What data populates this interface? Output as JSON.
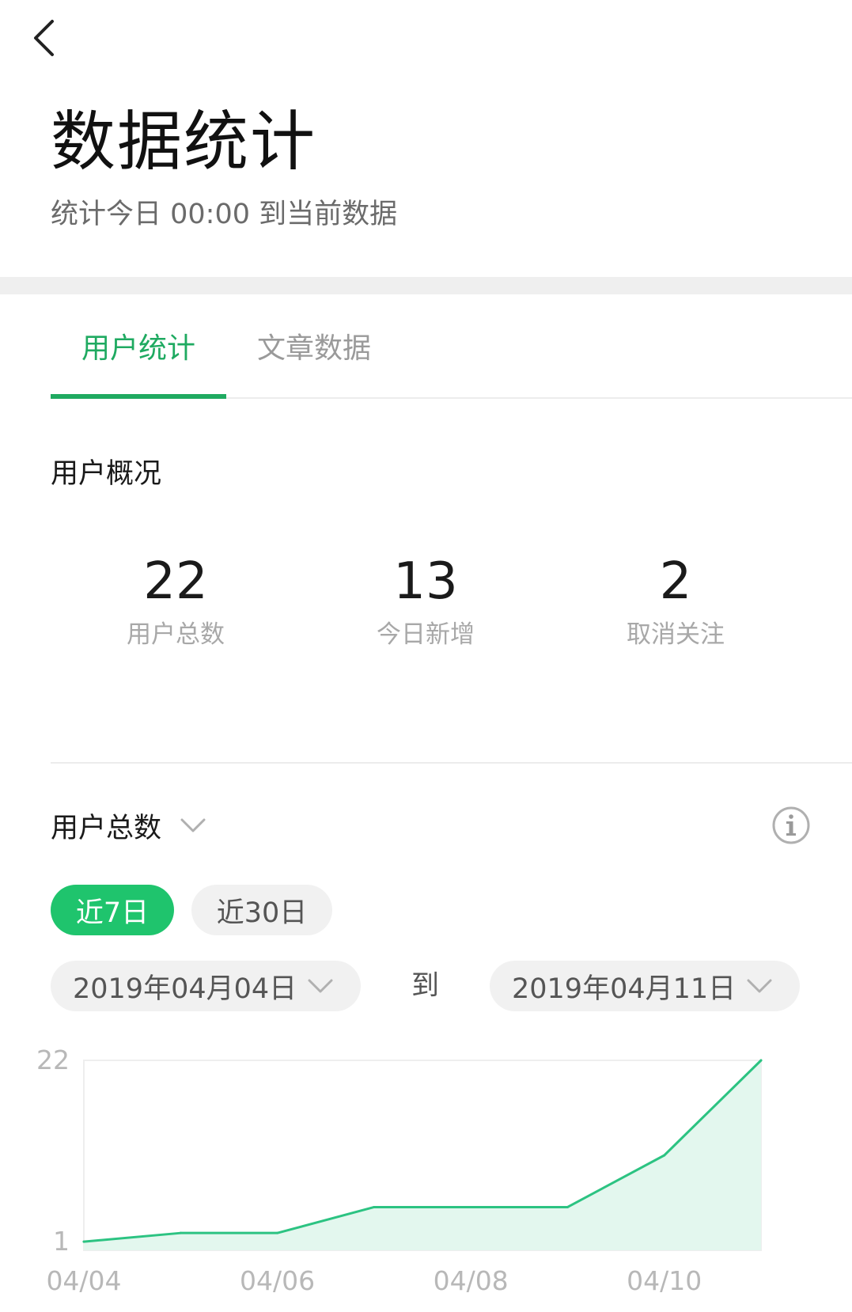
{
  "header": {
    "back_icon": "chevron-left-icon",
    "title": "数据统计",
    "subtitle": "统计今日 00:00 到当前数据"
  },
  "tabs": [
    {
      "label": "用户统计",
      "active": true
    },
    {
      "label": "文章数据",
      "active": false
    }
  ],
  "overview": {
    "title": "用户概况",
    "stats": [
      {
        "value": "22",
        "label": "用户总数"
      },
      {
        "value": "13",
        "label": "今日新增"
      },
      {
        "value": "2",
        "label": "取消关注"
      }
    ]
  },
  "metric": {
    "selected": "用户总数",
    "dropdown_icon": "chevron-down-icon",
    "info_icon": "info-icon"
  },
  "range_buttons": [
    {
      "label": "近7日",
      "active": true
    },
    {
      "label": "近30日",
      "active": false
    }
  ],
  "date_range": {
    "start": "2019年04月04日",
    "separator": "到",
    "end": "2019年04月11日"
  },
  "colors": {
    "accent": "#1faa61",
    "button_active": "#1fc46d",
    "line": "#2cc382",
    "area": "#e3f7ee"
  },
  "chart_data": {
    "type": "area",
    "x": [
      "04/04",
      "04/05",
      "04/06",
      "04/07",
      "04/08",
      "04/09",
      "04/10",
      "04/11"
    ],
    "y_ticks": [
      1,
      22
    ],
    "x_ticks": [
      "04/04",
      "04/06",
      "04/08",
      "04/10"
    ],
    "values": [
      1,
      2,
      2,
      5,
      5,
      5,
      11,
      22
    ],
    "ylim": [
      0,
      22
    ],
    "grid": true
  }
}
